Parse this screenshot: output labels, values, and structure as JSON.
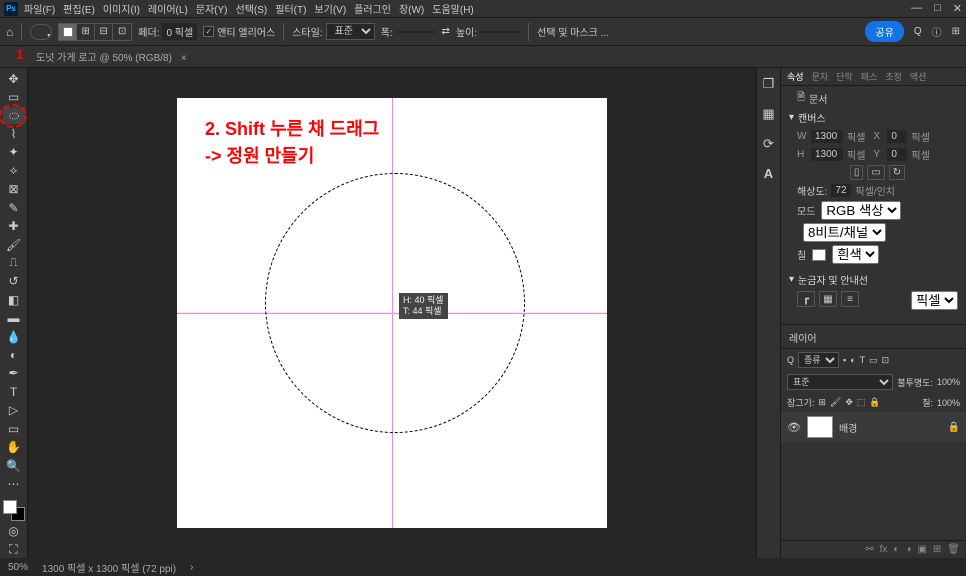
{
  "menu": {
    "file": "파일(F)",
    "edit": "편집(E)",
    "image": "이미지(I)",
    "layer": "레이어(L)",
    "type": "문자(Y)",
    "select": "선택(S)",
    "filter": "필터(T)",
    "view": "보기(V)",
    "plugin": "플러그인",
    "window": "창(W)",
    "help": "도움말(H)"
  },
  "optbar": {
    "feather_label": "페더:",
    "feather_value": "0 픽셀",
    "antialias": "앤티 앨리어스",
    "style_label": "스타일:",
    "style_value": "표준",
    "width_label": "폭:",
    "height_label": "높이:",
    "mask_label": "선택 및 마스크 ...",
    "share": "공유"
  },
  "tab": {
    "title": "도넛 가게 로고 @ 50% (RGB/8)",
    "close": "×"
  },
  "annotation": {
    "num": "1",
    "line1": "2. Shift 누른 채 드래그",
    "line2": "->  정원 만들기"
  },
  "tooltip": {
    "line1": "H: 40 픽셀",
    "line2": "T: 44 픽셀"
  },
  "props": {
    "tabs": {
      "prop": "속성",
      "type": "문자",
      "para": "단락",
      "path": "패스",
      "adj": "조정",
      "act": "액션"
    },
    "doc": "문서",
    "canvas": "캔버스",
    "w": "W",
    "w_val": "1300",
    "h": "H",
    "h_val": "1300",
    "unit": "픽셀",
    "x": "X",
    "x_val": "0",
    "y": "Y",
    "y_val": "0",
    "res_label": "해상도:",
    "res_val": "72",
    "res_unit": "픽셀/인치",
    "mode_label": "모드",
    "mode_val": "RGB 색상",
    "bits": "8비트/채널",
    "fill_label": "칠",
    "fill_val": "흰색",
    "rulers": "눈금자 및 안내선",
    "ruler_unit": "픽셀"
  },
  "layers": {
    "title": "레이어",
    "kind": "종류",
    "blend": "표준",
    "opacity_label": "불투명도:",
    "opacity": "100%",
    "lock_label": "잠그기:",
    "fill_label": "칠:",
    "fill": "100%",
    "bg": "배경"
  },
  "status": {
    "zoom": "50%",
    "info": "1300 픽셀 x 1300 픽셀 (72 ppi)"
  }
}
